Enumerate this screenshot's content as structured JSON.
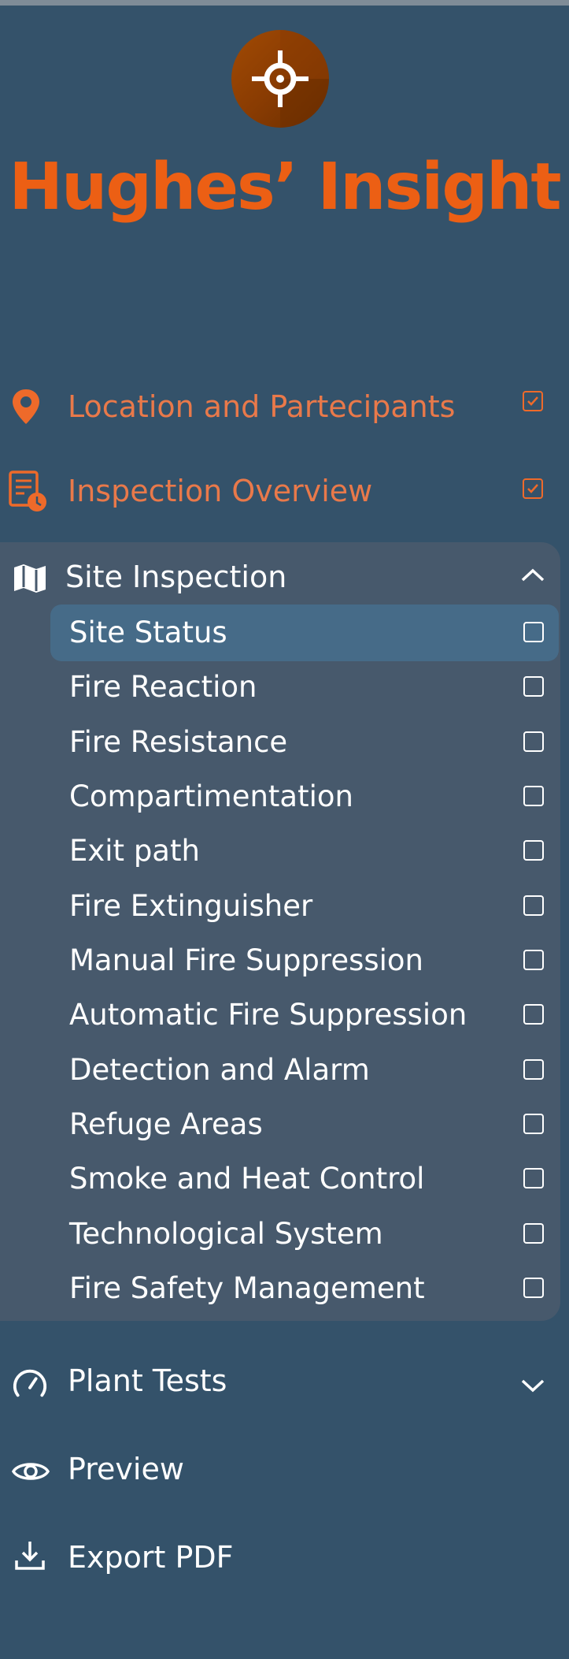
{
  "brand": {
    "name": "Hughes’ Insight",
    "logo_icon": "crosshair-icon",
    "logo_color": "#a14a04",
    "brand_color": "#ec5f14"
  },
  "colors": {
    "background": "#34526a",
    "section_background": "#47596c",
    "active_item": "#466b88",
    "completed_text": "#e9794a",
    "accent": "#ee6a2a"
  },
  "nav": {
    "location": {
      "label": "Location and Partecipants",
      "icon": "map-pin-icon",
      "checked": true
    },
    "overview": {
      "label": "Inspection Overview",
      "icon": "report-clock-icon",
      "checked": true
    },
    "site_inspection": {
      "label": "Site Inspection",
      "icon": "map-icon",
      "expanded": true,
      "active_index": 0,
      "items": [
        {
          "label": "Site Status",
          "checked": false
        },
        {
          "label": "Fire Reaction",
          "checked": false
        },
        {
          "label": "Fire Resistance",
          "checked": false
        },
        {
          "label": "Compartimentation",
          "checked": false
        },
        {
          "label": "Exit path",
          "checked": false
        },
        {
          "label": "Fire Extinguisher",
          "checked": false
        },
        {
          "label": "Manual Fire Suppression",
          "checked": false
        },
        {
          "label": "Automatic Fire Suppression",
          "checked": false
        },
        {
          "label": "Detection and Alarm",
          "checked": false
        },
        {
          "label": "Refuge Areas",
          "checked": false
        },
        {
          "label": "Smoke and Heat Control",
          "checked": false
        },
        {
          "label": "Technological System",
          "checked": false
        },
        {
          "label": "Fire Safety Management",
          "checked": false
        }
      ]
    },
    "plant_tests": {
      "label": "Plant Tests",
      "icon": "gauge-icon",
      "expanded": false
    },
    "preview": {
      "label": "Preview",
      "icon": "eye-icon"
    },
    "export_pdf": {
      "label": "Export PDF",
      "icon": "download-icon"
    }
  }
}
